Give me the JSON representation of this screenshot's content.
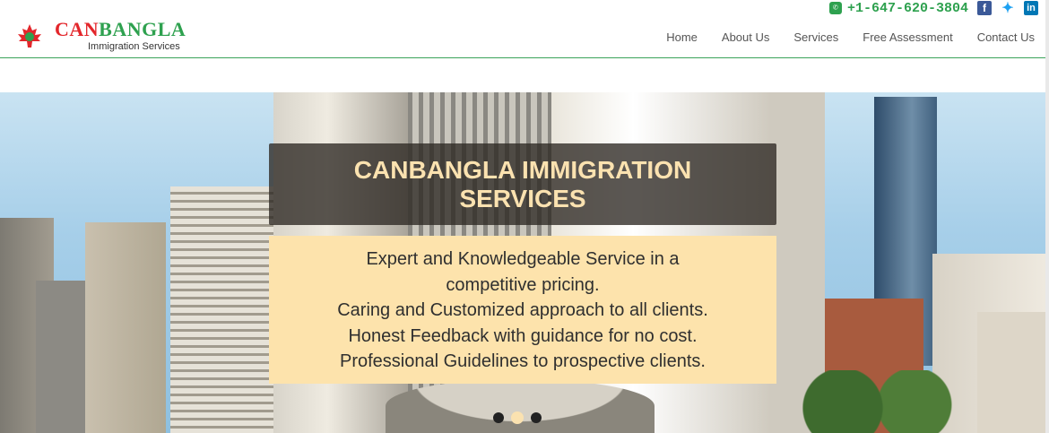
{
  "brand": {
    "can": "CAN",
    "bangla": "BANGLA",
    "tagline": "Immigration Services"
  },
  "contact": {
    "phone": "+1-647-620-3804"
  },
  "social": [
    {
      "name": "facebook-icon",
      "glyph": "f"
    },
    {
      "name": "twitter-icon",
      "glyph": "🐦"
    },
    {
      "name": "linkedin-icon",
      "glyph": "in"
    }
  ],
  "nav": {
    "items": [
      "Home",
      "About Us",
      "Services",
      "Free Assessment",
      "Contact Us"
    ]
  },
  "hero": {
    "title_line1": "CANBANGLA IMMIGRATION",
    "title_line2": "SERVICES",
    "lines": [
      "Expert and Knowledgeable Service in a",
      "competitive pricing.",
      "Caring and Customized approach to all clients.",
      "Honest Feedback with guidance for no cost.",
      "Professional Guidelines to prospective clients."
    ],
    "slides": 3,
    "active_slide": 2
  },
  "colors": {
    "red": "#e3262b",
    "green": "#2ea14f",
    "title_box": "#2d2823",
    "desc_box": "#fde3ac"
  }
}
